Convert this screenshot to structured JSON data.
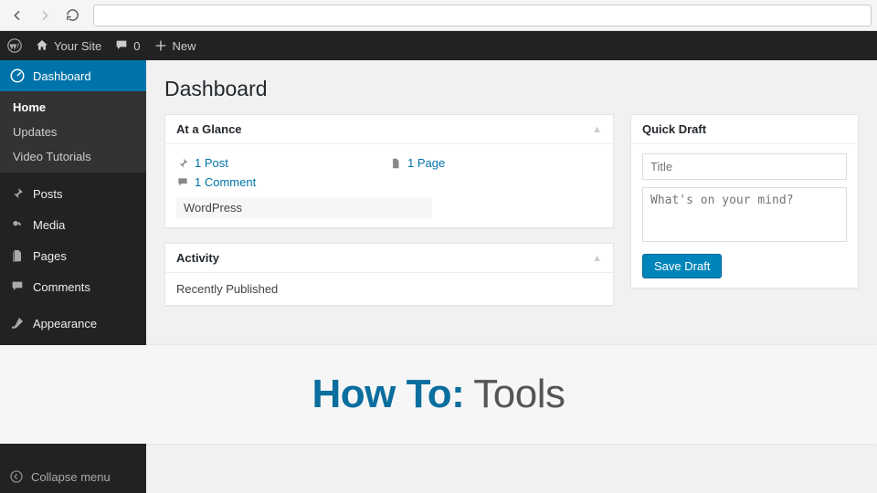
{
  "browser": {
    "url": ""
  },
  "adminbar": {
    "site_name": "Your Site",
    "comment_count": "0",
    "new_label": "New"
  },
  "sidebar": {
    "dashboard": "Dashboard",
    "submenu": [
      "Home",
      "Updates",
      "Video Tutorials"
    ],
    "items": [
      "Posts",
      "Media",
      "Pages",
      "Comments",
      "Appearance"
    ],
    "collapse": "Collapse menu"
  },
  "page": {
    "title": "Dashboard"
  },
  "glance": {
    "title": "At a Glance",
    "post": "1 Post",
    "page": "1 Page",
    "comment": "1 Comment",
    "version": "WordPress"
  },
  "activity": {
    "title": "Activity",
    "recent": "Recently Published"
  },
  "quickdraft": {
    "title": "Quick Draft",
    "title_ph": "Title",
    "content_ph": "What's on your mind?",
    "save": "Save Draft"
  },
  "overlay": {
    "bold": "How To:",
    "rest": "Tools"
  }
}
